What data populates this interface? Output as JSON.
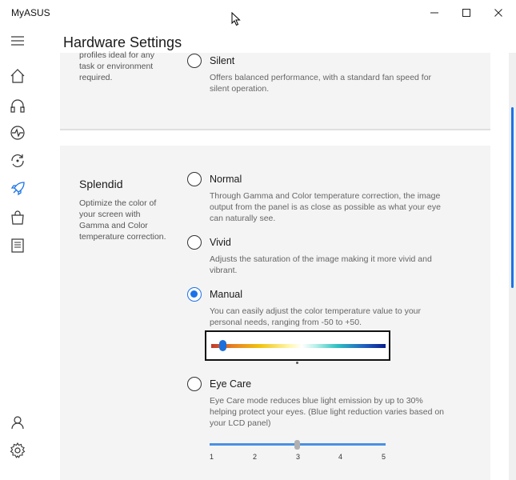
{
  "window": {
    "app_name": "MyASUS",
    "minimize_icon": "minimize-icon",
    "maximize_icon": "maximize-icon",
    "close_icon": "close-icon"
  },
  "sidebar": {
    "items": [
      {
        "icon": "hamburger-menu-icon"
      },
      {
        "icon": "home-icon"
      },
      {
        "icon": "headset-icon"
      },
      {
        "icon": "diagnostics-icon"
      },
      {
        "icon": "sync-icon"
      },
      {
        "icon": "rocket-icon",
        "active": true
      },
      {
        "icon": "store-bag-icon"
      },
      {
        "icon": "news-icon"
      },
      {
        "icon": "user-icon"
      },
      {
        "icon": "settings-gear-icon"
      }
    ]
  },
  "header": {
    "title": "Hardware Settings"
  },
  "fan_section": {
    "left_desc": "profiles ideal for any task or environment required.",
    "silent": {
      "label": "Silent",
      "desc": "Offers balanced performance, with a standard fan speed for silent operation."
    }
  },
  "splendid": {
    "title": "Splendid",
    "desc": "Optimize the color of your screen with Gamma and Color temperature correction.",
    "options": [
      {
        "label": "Normal",
        "desc": "Through Gamma and Color temperature correction, the image output from the panel is as close as possible as what your eye can naturally see.",
        "selected": false
      },
      {
        "label": "Vivid",
        "desc": "Adjusts the saturation of the image making it more vivid and vibrant.",
        "selected": false
      },
      {
        "label": "Manual",
        "desc": "You can easily adjust the color temperature value to your personal needs, ranging from -50 to +50.",
        "selected": true
      },
      {
        "label": "Eye Care",
        "desc": "Eye Care mode reduces blue light emission by up to 30% helping protect your eyes. (Blue light reduction varies based on your LCD panel)",
        "selected": false
      }
    ],
    "color_temperature": {
      "min": -50,
      "max": 50,
      "value": -45
    },
    "eye_care_level": {
      "ticks": [
        "1",
        "2",
        "3",
        "4",
        "5"
      ],
      "value": 3
    }
  },
  "colors": {
    "accent": "#1a73e8",
    "card_bg": "#f4f4f5"
  }
}
